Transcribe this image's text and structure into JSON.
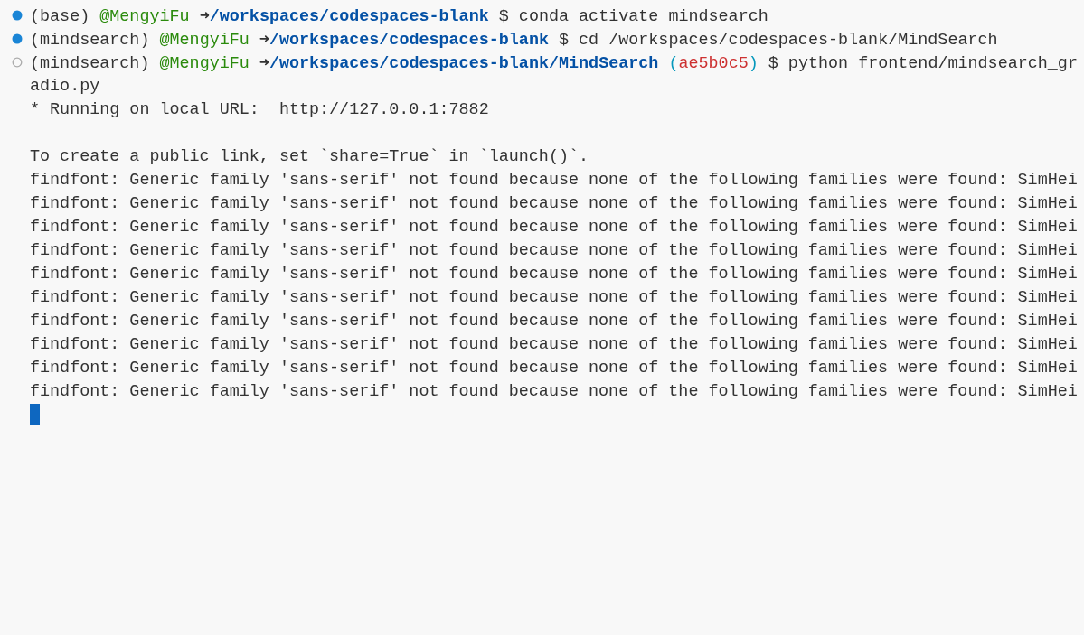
{
  "lines": [
    {
      "kind": "prompt",
      "finished": true,
      "env": "(base)",
      "user": "@MengyiFu",
      "arrow": "➜",
      "path": "/workspaces/codespaces-blank",
      "dollar": "$",
      "command": "conda activate mindsearch"
    },
    {
      "kind": "prompt",
      "finished": true,
      "env": "(mindsearch)",
      "user": "@MengyiFu",
      "arrow": "➜",
      "path": "/workspaces/codespaces-blank",
      "dollar": "$",
      "command": "cd /workspaces/codespaces-blank/MindSearch"
    },
    {
      "kind": "prompt",
      "finished": false,
      "env": "(mindsearch)",
      "user": "@MengyiFu",
      "arrow": "➜",
      "path": "/workspaces/codespaces-blank/MindSearch",
      "branch_open": "(",
      "branch": "ae5b0c5",
      "branch_close": ")",
      "dollar": "$",
      "command": "python frontend/mindsearch_gr"
    },
    {
      "kind": "output",
      "text": "adio.py"
    },
    {
      "kind": "output",
      "text": "* Running on local URL:  http://127.0.0.1:7882"
    },
    {
      "kind": "blank"
    },
    {
      "kind": "output",
      "text": "To create a public link, set `share=True` in `launch()`."
    },
    {
      "kind": "output",
      "text": "findfont: Generic family 'sans-serif' not found because none of the following families were found: SimHei"
    },
    {
      "kind": "output",
      "text": "findfont: Generic family 'sans-serif' not found because none of the following families were found: SimHei"
    },
    {
      "kind": "output",
      "text": "findfont: Generic family 'sans-serif' not found because none of the following families were found: SimHei"
    },
    {
      "kind": "output",
      "text": "findfont: Generic family 'sans-serif' not found because none of the following families were found: SimHei"
    },
    {
      "kind": "output",
      "text": "findfont: Generic family 'sans-serif' not found because none of the following families were found: SimHei"
    },
    {
      "kind": "output",
      "text": "findfont: Generic family 'sans-serif' not found because none of the following families were found: SimHei"
    },
    {
      "kind": "output",
      "text": "findfont: Generic family 'sans-serif' not found because none of the following families were found: SimHei"
    },
    {
      "kind": "output",
      "text": "findfont: Generic family 'sans-serif' not found because none of the following families were found: SimHei"
    },
    {
      "kind": "output",
      "text": "findfont: Generic family 'sans-serif' not found because none of the following families were found: SimHei"
    },
    {
      "kind": "output",
      "text": "findfont: Generic family 'sans-serif' not found because none of the following families were found: SimHei"
    },
    {
      "kind": "cursor"
    }
  ]
}
